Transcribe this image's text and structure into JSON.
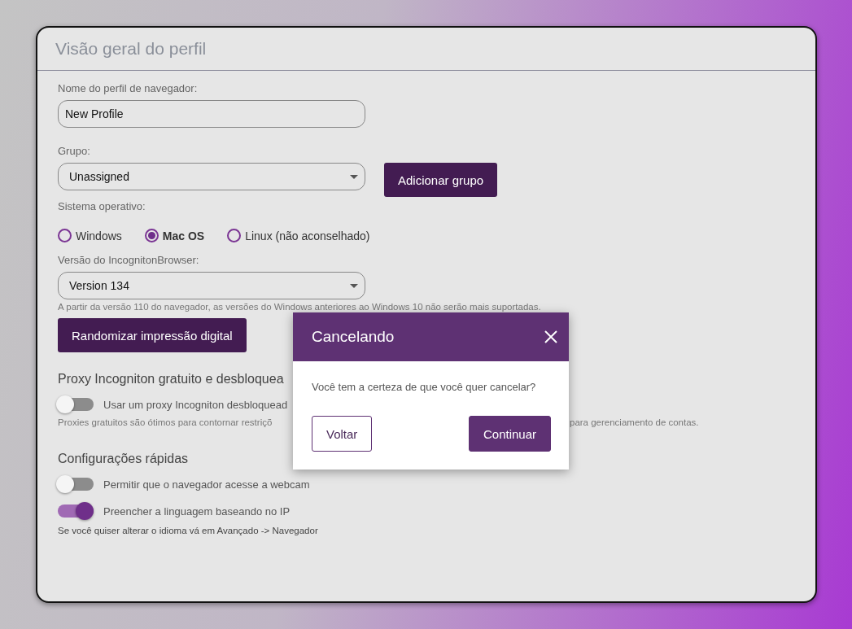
{
  "card": {
    "title": "Visão geral do perfil"
  },
  "profile_name": {
    "label": "Nome do perfil de navegador:",
    "value": "New Profile"
  },
  "group": {
    "label": "Grupo:",
    "value": "Unassigned",
    "add_button": "Adicionar grupo"
  },
  "os": {
    "label": "Sistema operativo:",
    "options": [
      {
        "label": "Windows",
        "selected": false
      },
      {
        "label": "Mac OS",
        "selected": true
      },
      {
        "label": "Linux (não aconselhado)",
        "selected": false
      }
    ]
  },
  "version": {
    "label": "Versão do IncognitonBrowser:",
    "value": "Version 134",
    "note": "A partir da versão 110 do navegador, as versões do Windows anteriores ao Windows 10 não serão mais suportadas."
  },
  "randomize_button": "Randomizar impressão digital",
  "proxy": {
    "heading": "Proxy Incogniton gratuito e desbloquea",
    "toggle": {
      "label": "Usar um proxy Incogniton desbloquead",
      "on": false
    },
    "description_left": "Proxies gratuitos são ótimos para contornar restriçõ",
    "description_right": "para gerenciamento de contas."
  },
  "quick_settings": {
    "heading": "Configurações rápidas",
    "toggles": [
      {
        "label": "Permitir que o navegador acesse a webcam",
        "on": false
      },
      {
        "label": "Preencher a linguagem baseando no IP",
        "on": true
      }
    ],
    "note": "Se você quiser alterar o idioma vá em Avançado -> Navegador"
  },
  "dialog": {
    "title": "Cancelando",
    "message": "Você tem a certeza de que você quer cancelar?",
    "buttons": [
      {
        "label": "Voltar",
        "kind": "outline"
      },
      {
        "label": "Continuar",
        "kind": "filled"
      }
    ]
  }
}
